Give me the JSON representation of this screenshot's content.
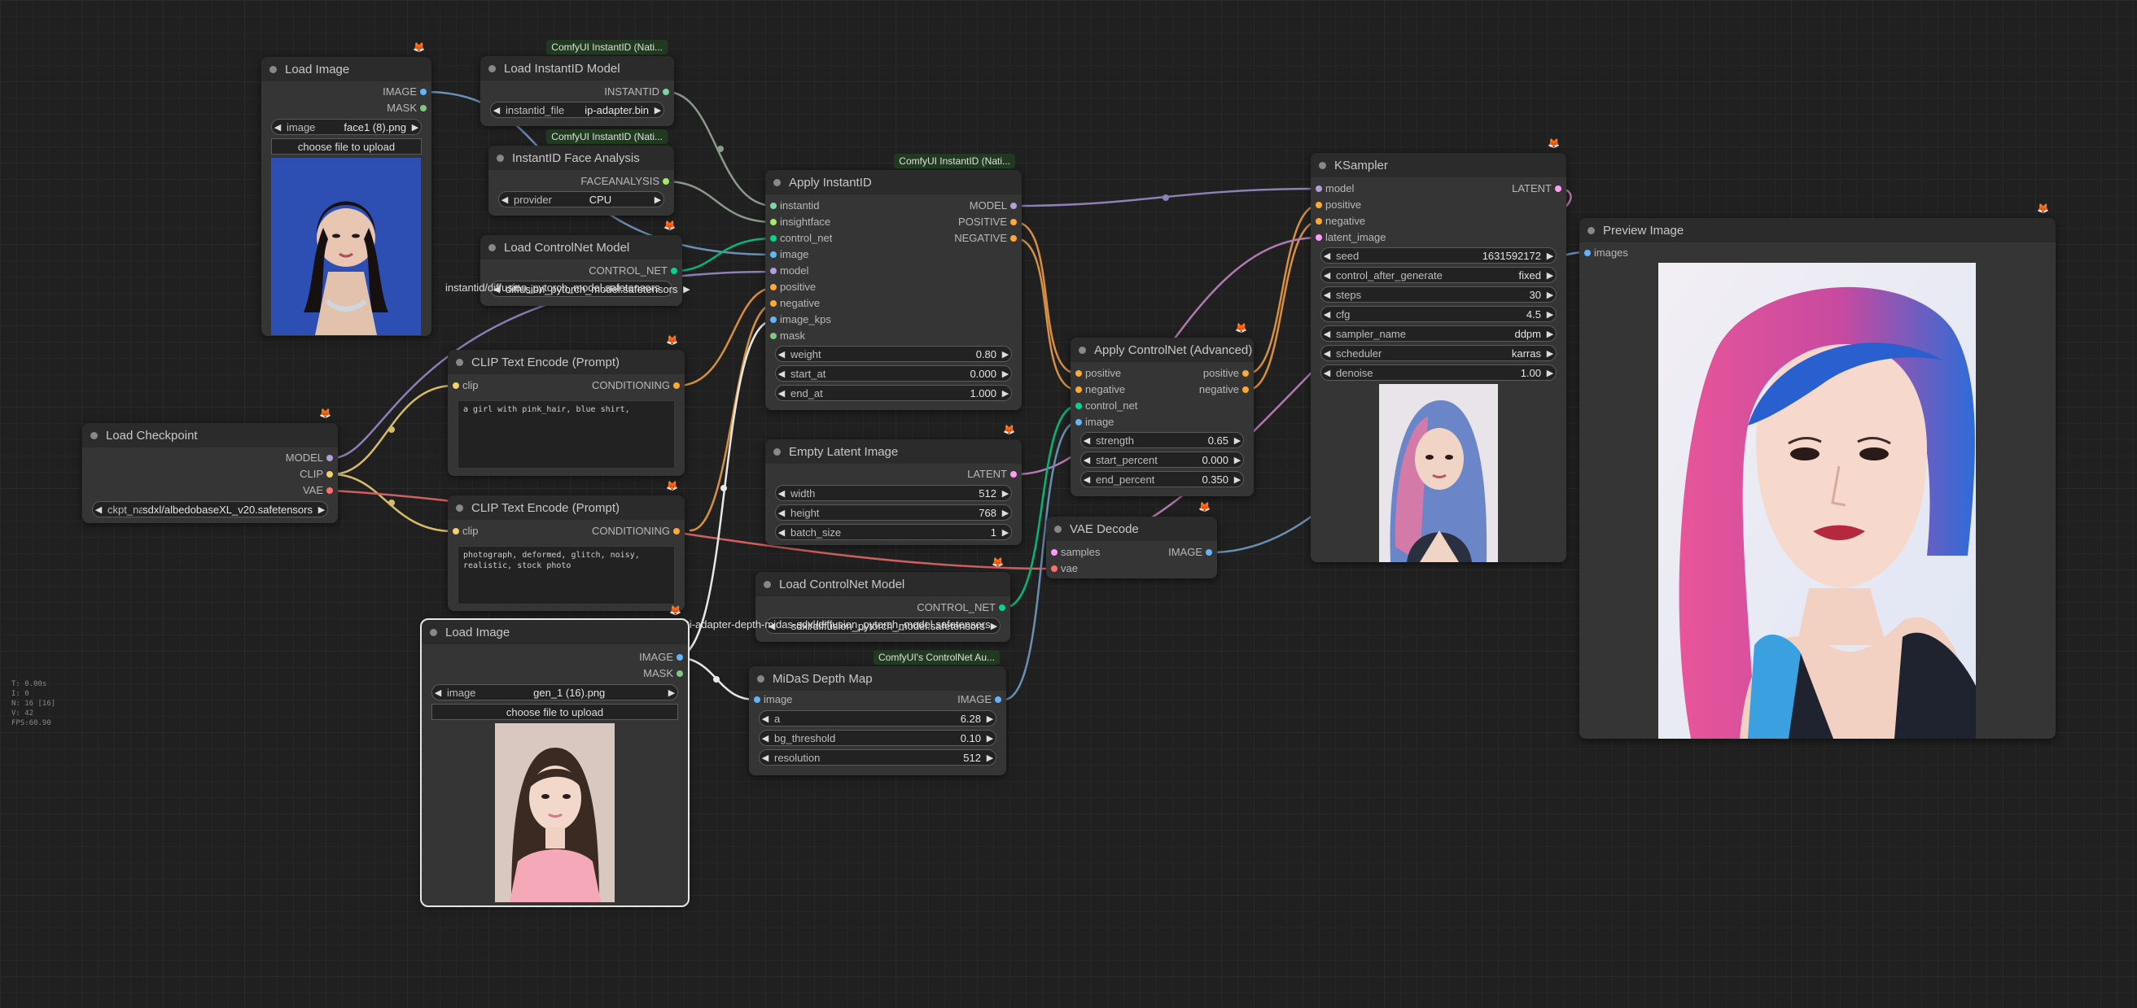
{
  "colors": {
    "clip": "#f1d172",
    "model": "#b39ddb",
    "vae": "#ff6e6e",
    "conditioning": "#ffa931",
    "latent": "#ff9cf9",
    "image": "#64b5f6",
    "mask": "#81c784",
    "control_net": "#00d78d",
    "instantid": "#7bd6a6",
    "faceanalysis": "#a7e86b"
  },
  "nodes": {
    "load_image_1": {
      "title": "Load Image",
      "outputs": [
        "IMAGE",
        "MASK"
      ],
      "widget": {
        "label": "image",
        "value": "face1 (8).png"
      },
      "button": "choose file to upload"
    },
    "load_instantid_model": {
      "badge": "ComfyUI InstantID (Nati...",
      "title": "Load InstantID Model",
      "output": "INSTANTID",
      "widget": {
        "label": "instantid_file",
        "value": "ip-adapter.bin"
      }
    },
    "instantid_face_analysis": {
      "badge": "ComfyUI InstantID (Nati...",
      "title": "InstantID Face Analysis",
      "output": "FACEANALYSIS",
      "widget": {
        "label": "provider",
        "value": "CPU"
      }
    },
    "load_controlnet_model_1": {
      "title": "Load ControlNet Model",
      "output": "CONTROL_NET",
      "widget": {
        "label": "",
        "value": "diffusion_pytorch_model.safetensors"
      },
      "overlap_text": "instantid/diffusion_pytorch_model.safetensors"
    },
    "apply_instantid": {
      "badge": "ComfyUI InstantID (Nati...",
      "title": "Apply InstantID",
      "inputs": [
        "instantid",
        "insightface",
        "control_net",
        "image",
        "model",
        "positive",
        "negative",
        "image_kps",
        "mask"
      ],
      "outputs": [
        "MODEL",
        "POSITIVE",
        "NEGATIVE"
      ],
      "widgets": [
        {
          "label": "weight",
          "value": "0.80"
        },
        {
          "label": "start_at",
          "value": "0.000"
        },
        {
          "label": "end_at",
          "value": "1.000"
        }
      ]
    },
    "clip_text_encode_pos": {
      "title": "CLIP Text Encode (Prompt)",
      "input": "clip",
      "output": "CONDITIONING",
      "text": "a girl with pink_hair, blue shirt,"
    },
    "clip_text_encode_neg": {
      "title": "CLIP Text Encode (Prompt)",
      "input": "clip",
      "output": "CONDITIONING",
      "text": "photograph, deformed, glitch, noisy, realistic, stock photo"
    },
    "load_checkpoint": {
      "title": "Load Checkpoint",
      "outputs": [
        "MODEL",
        "CLIP",
        "VAE"
      ],
      "widget": {
        "label": "ckpt_name",
        "value": "sdxl/albedobaseXL_v20.safetensors"
      }
    },
    "empty_latent": {
      "title": "Empty Latent Image",
      "output": "LATENT",
      "widgets": [
        {
          "label": "width",
          "value": "512"
        },
        {
          "label": "height",
          "value": "768"
        },
        {
          "label": "batch_size",
          "value": "1"
        }
      ]
    },
    "apply_controlnet_adv": {
      "title": "Apply ControlNet (Advanced)",
      "inputs": [
        "positive",
        "negative",
        "control_net",
        "image"
      ],
      "outputs": [
        "positive",
        "negative"
      ],
      "widgets": [
        {
          "label": "strength",
          "value": "0.65"
        },
        {
          "label": "start_percent",
          "value": "0.000"
        },
        {
          "label": "end_percent",
          "value": "0.350"
        }
      ]
    },
    "vae_decode": {
      "title": "VAE Decode",
      "inputs": [
        "samples",
        "vae"
      ],
      "output": "IMAGE"
    },
    "load_controlnet_model_2": {
      "title": "Load ControlNet Model",
      "output": "CONTROL_NET",
      "widget": {
        "label": "",
        "value": "sdxl/diffusion_pytorch_model.safetensors"
      },
      "overlap_text": "t2i-adapter-depth-midas-sdxl/diffusion_pytorch_model.safetensors"
    },
    "load_image_2": {
      "title": "Load Image",
      "outputs": [
        "IMAGE",
        "MASK"
      ],
      "widget": {
        "label": "image",
        "value": "gen_1 (16).png"
      },
      "button": "choose file to upload"
    },
    "midas_depth_map": {
      "badge": "ComfyUI's ControlNet Au...",
      "title": "MiDaS Depth Map",
      "input": "image",
      "output": "IMAGE",
      "widgets": [
        {
          "label": "a",
          "value": "6.28"
        },
        {
          "label": "bg_threshold",
          "value": "0.10"
        },
        {
          "label": "resolution",
          "value": "512"
        }
      ]
    },
    "ksampler": {
      "title": "KSampler",
      "inputs": [
        "model",
        "positive",
        "negative",
        "latent_image"
      ],
      "output": "LATENT",
      "widgets": [
        {
          "label": "seed",
          "value": "1631592172"
        },
        {
          "label": "control_after_generate",
          "value": "fixed"
        },
        {
          "label": "steps",
          "value": "30"
        },
        {
          "label": "cfg",
          "value": "4.5"
        },
        {
          "label": "sampler_name",
          "value": "ddpm"
        },
        {
          "label": "scheduler",
          "value": "karras"
        },
        {
          "label": "denoise",
          "value": "1.00"
        }
      ]
    },
    "preview_image": {
      "title": "Preview Image",
      "input": "images"
    }
  },
  "stats": {
    "t": "T: 0.00s",
    "i": "I: 0",
    "n": "N: 16 [16]",
    "v": "V: 42",
    "fps": "FPS:60.90"
  }
}
